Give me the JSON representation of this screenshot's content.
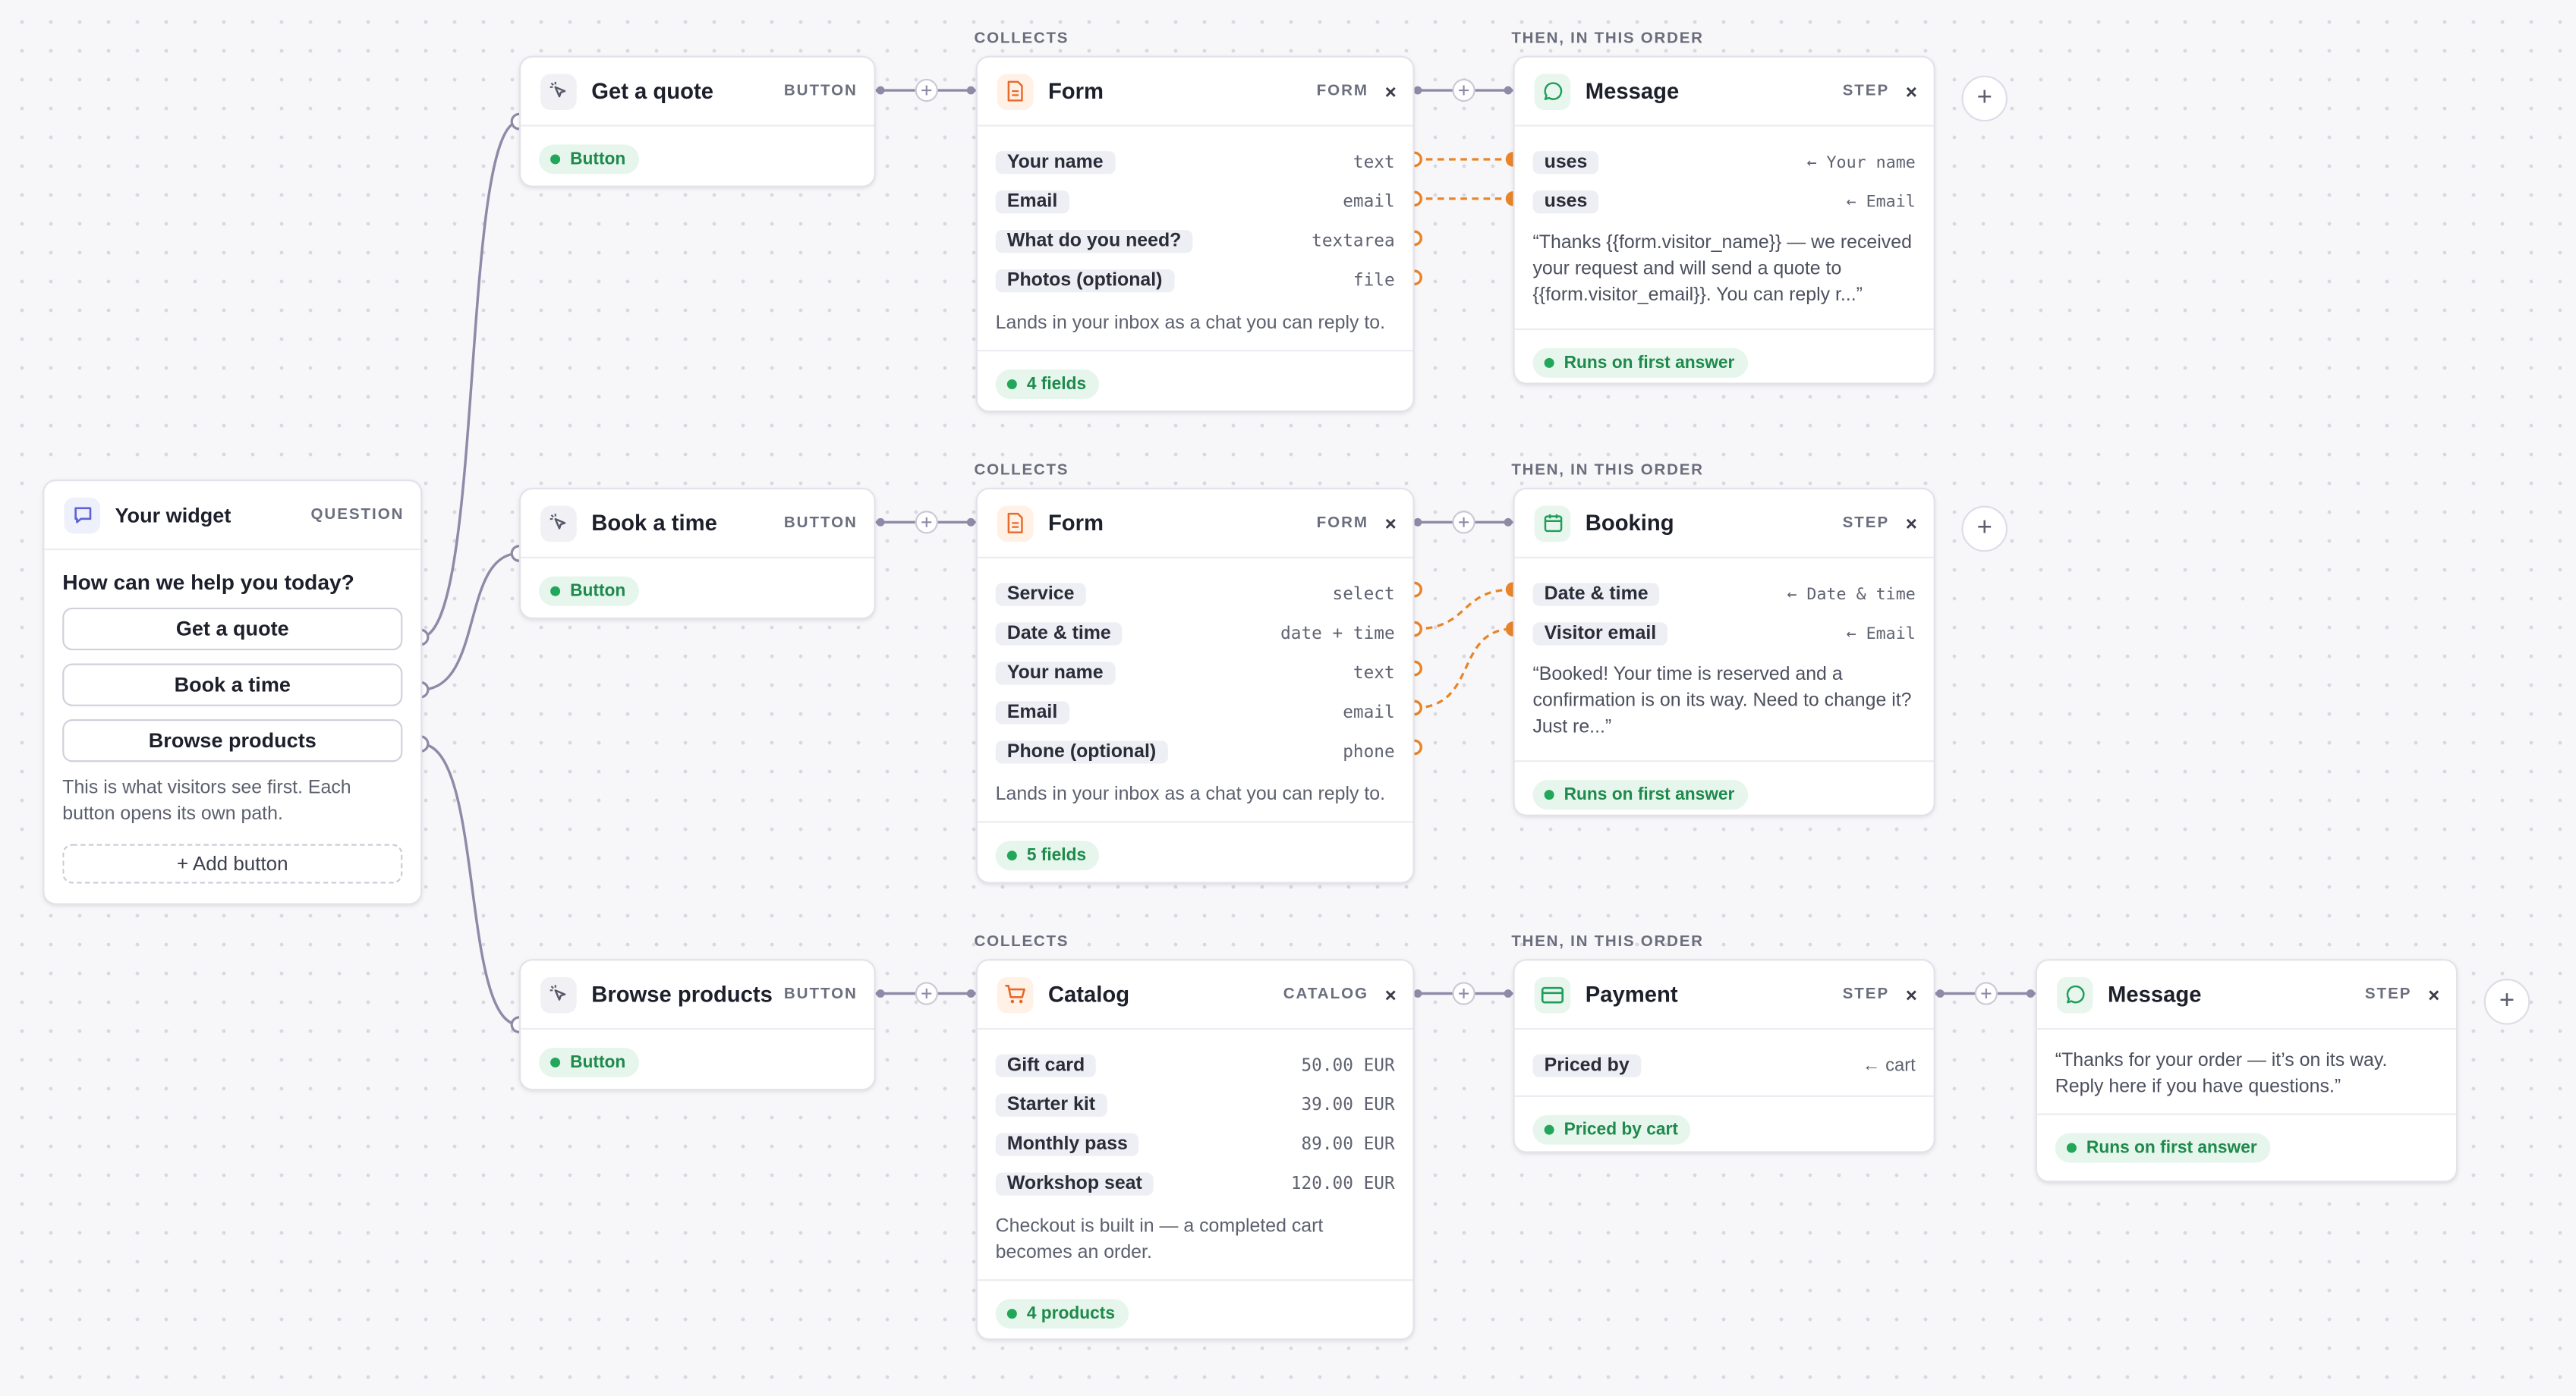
{
  "widget": {
    "title": "Your widget",
    "tag": "QUESTION",
    "question": "How can we help you today?",
    "buttons": [
      "Get a quote",
      "Book a time",
      "Browse products"
    ],
    "note": "This is what visitors see first. Each button opens its own path.",
    "add_button": "+ Add button"
  },
  "button_nodes": [
    {
      "title": "Get a quote",
      "tag": "BUTTON",
      "badge": "Button"
    },
    {
      "title": "Book a time",
      "tag": "BUTTON",
      "badge": "Button"
    },
    {
      "title": "Browse products",
      "tag": "BUTTON",
      "badge": "Button"
    }
  ],
  "labels": {
    "collects": "COLLECTS",
    "then": "THEN, IN THIS ORDER"
  },
  "form1": {
    "title": "Form",
    "tag": "FORM",
    "close": "×",
    "fields": [
      {
        "name": "Your name",
        "type": "text"
      },
      {
        "name": "Email",
        "type": "email"
      },
      {
        "name": "What do you need?",
        "type": "textarea"
      },
      {
        "name": "Photos (optional)",
        "type": "file"
      }
    ],
    "note": "Lands in your inbox as a chat you can reply to.",
    "badge": "4 fields"
  },
  "form2": {
    "title": "Form",
    "tag": "FORM",
    "close": "×",
    "fields": [
      {
        "name": "Service",
        "type": "select"
      },
      {
        "name": "Date & time",
        "type": "date + time"
      },
      {
        "name": "Your name",
        "type": "text"
      },
      {
        "name": "Email",
        "type": "email"
      },
      {
        "name": "Phone (optional)",
        "type": "phone"
      }
    ],
    "note": "Lands in your inbox as a chat you can reply to.",
    "badge": "5 fields"
  },
  "catalog": {
    "title": "Catalog",
    "tag": "CATALOG",
    "close": "×",
    "items": [
      {
        "name": "Gift card",
        "price": "50.00 EUR"
      },
      {
        "name": "Starter kit",
        "price": "39.00 EUR"
      },
      {
        "name": "Monthly pass",
        "price": "89.00 EUR"
      },
      {
        "name": "Workshop seat",
        "price": "120.00 EUR"
      }
    ],
    "note": "Checkout is built in — a completed cart becomes an order.",
    "badge": "4 products"
  },
  "message1": {
    "title": "Message",
    "tag": "STEP",
    "close": "×",
    "uses": [
      {
        "label": "uses",
        "source": "← Your name"
      },
      {
        "label": "uses",
        "source": "← Email"
      }
    ],
    "text": "“Thanks {{form.visitor_name}} — we received your request and will send a quote to {{form.visitor_email}}. You can reply r...”",
    "badge": "Runs on first answer"
  },
  "booking": {
    "title": "Booking",
    "tag": "STEP",
    "close": "×",
    "uses": [
      {
        "label": "Date & time",
        "source": "← Date & time"
      },
      {
        "label": "Visitor email",
        "source": "← Email"
      }
    ],
    "text": "“Booked! Your time is reserved and a confirmation is on its way. Need to change it? Just re...”",
    "badge": "Runs on first answer"
  },
  "payment": {
    "title": "Payment",
    "tag": "STEP",
    "close": "×",
    "priced_label": "Priced by",
    "priced_source": "← cart",
    "badge": "Priced by cart"
  },
  "message2": {
    "title": "Message",
    "tag": "STEP",
    "close": "×",
    "text": "“Thanks for your order — it’s on its way. Reply here if you have questions.”",
    "badge": "Runs on first answer"
  },
  "plus_label": "+",
  "colors": {
    "accent_orange": "#e8852a",
    "wire": "#8e8aa8",
    "green": "#22a65a"
  }
}
